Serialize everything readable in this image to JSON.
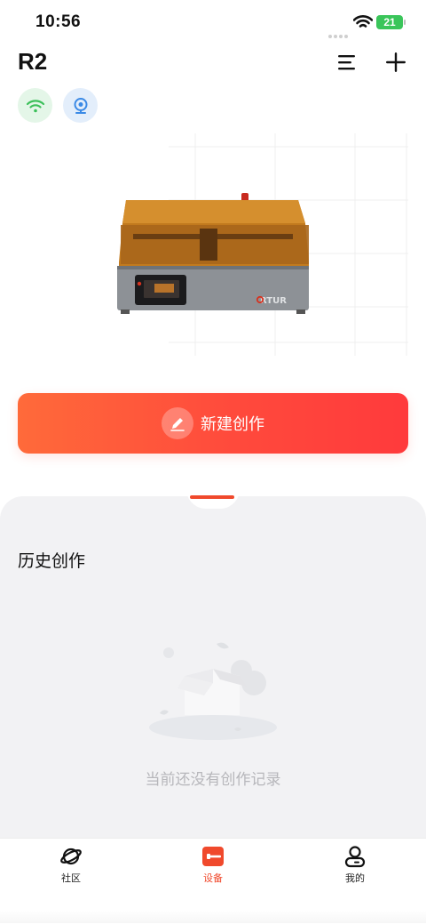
{
  "status_bar": {
    "time": "10:56",
    "battery": "21"
  },
  "header": {
    "title": "R2"
  },
  "device": {
    "brand_mark": "RTUR"
  },
  "actions": {
    "new_creation_label": "新建创作"
  },
  "history": {
    "title": "历史创作",
    "empty_text": "当前还没有创作记录"
  },
  "tabbar": {
    "items": [
      {
        "label": "社区",
        "icon": "planet-icon",
        "active": false
      },
      {
        "label": "设备",
        "icon": "device-icon",
        "active": true
      },
      {
        "label": "我的",
        "icon": "profile-icon",
        "active": false
      }
    ]
  },
  "colors": {
    "accent": "#f0492c",
    "wifi_chip_bg": "#e4f6e8",
    "camera_chip_bg": "#e3eefb",
    "panel_bg": "#f2f2f4"
  }
}
